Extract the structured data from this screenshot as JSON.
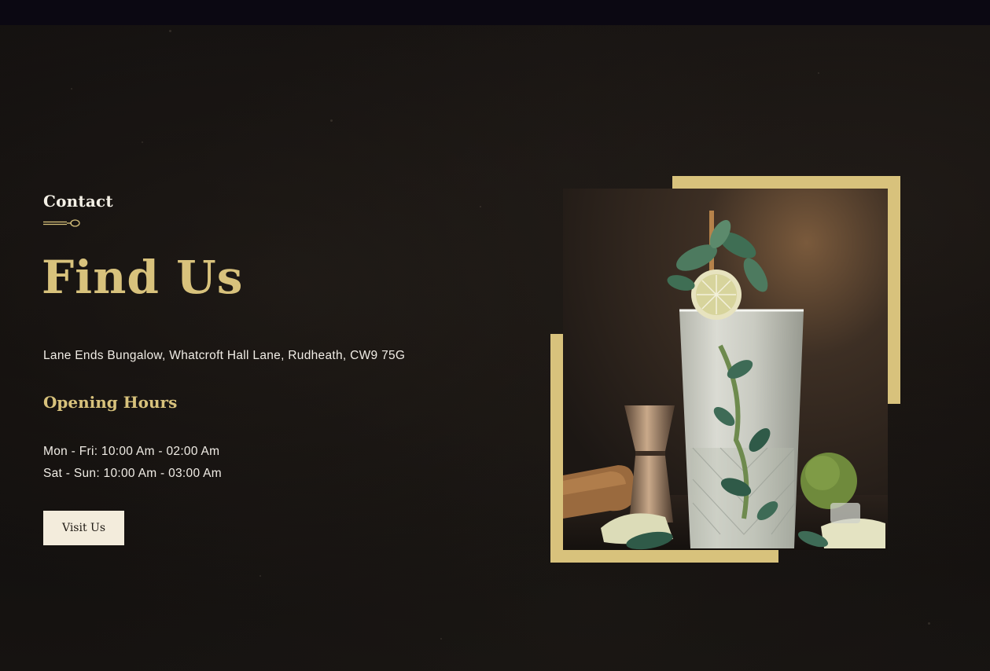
{
  "contact": {
    "eyebrow": "Contact",
    "title": "Find Us",
    "address": "Lane Ends Bungalow, Whatcroft Hall Lane, Rudheath, CW9 75G",
    "opening_hours": {
      "heading": "Opening Hours",
      "lines": [
        "Mon - Fri: 10:00 Am - 02:00 Am",
        "Sat - Sun: 10:00 Am - 03:00 Am"
      ]
    },
    "button_label": "Visit Us"
  },
  "colors": {
    "accent": "#d8c27c",
    "button_bg": "#f3ecdc",
    "text": "#f1ede6",
    "background": "#100d0c",
    "topbar": "#0b0812"
  },
  "icons": {
    "divider": "spoon-divider-icon"
  }
}
